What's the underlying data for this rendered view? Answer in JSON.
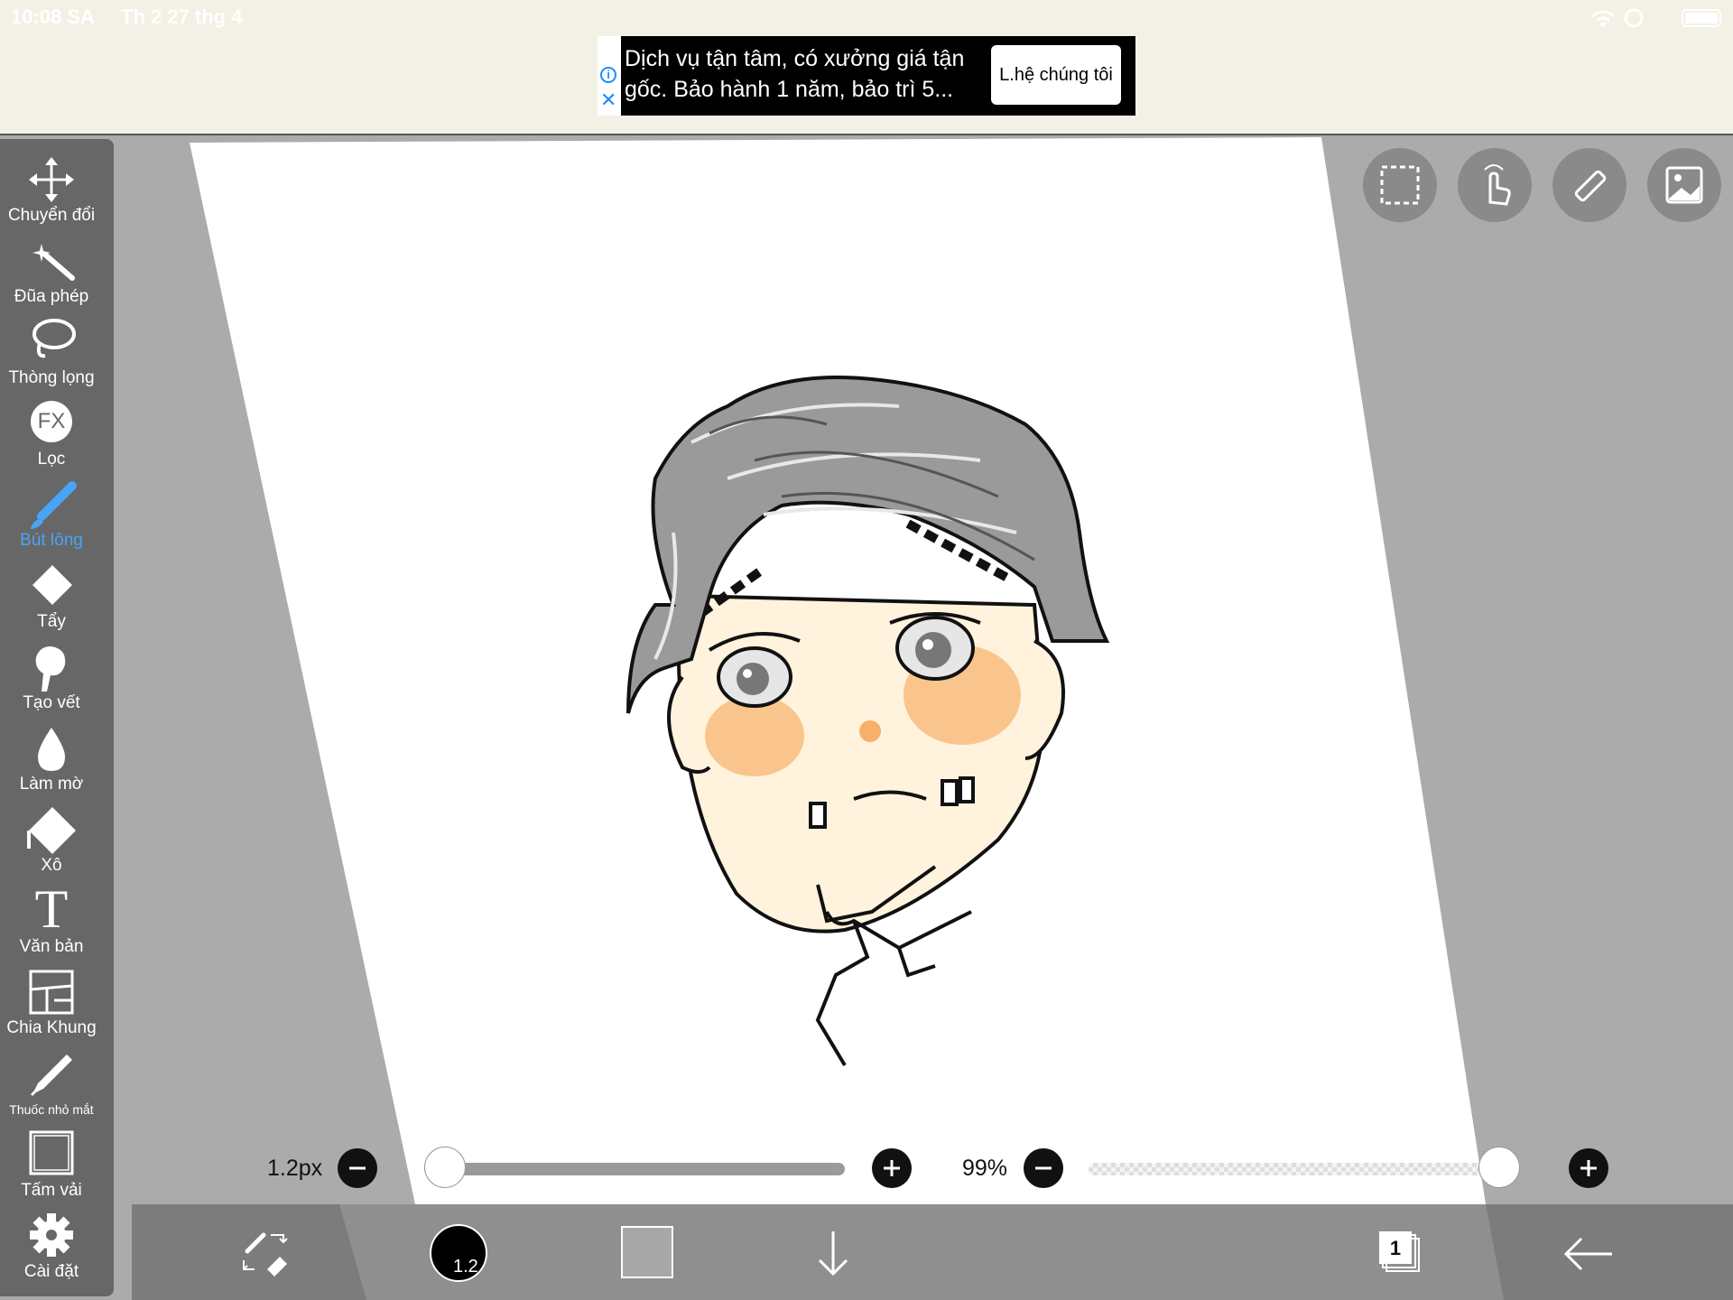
{
  "status": {
    "time": "10:08 SA",
    "date": "Th 2 27 thg 4"
  },
  "ad": {
    "text": "Dịch vụ tận tâm, có xưởng giá tận gốc. Bảo hành 1 năm, bảo trì 5...",
    "cta": "L.hệ chúng tôi",
    "info_icon": "i",
    "close_icon": "✕"
  },
  "sidebar": {
    "tools": [
      {
        "label": "Chuyển đổi"
      },
      {
        "label": "Đũa phép"
      },
      {
        "label": "Thòng lọng"
      },
      {
        "label": "Lọc",
        "icon_text": "FX"
      },
      {
        "label": "Bút lông"
      },
      {
        "label": "Tẩy"
      },
      {
        "label": "Tạo vết"
      },
      {
        "label": "Làm mờ"
      },
      {
        "label": "Xô"
      },
      {
        "label": "Văn bản",
        "icon_text": "T"
      },
      {
        "label": "Chia Khung"
      },
      {
        "label": "Thuốc nhỏ mắt"
      },
      {
        "label": "Tấm vải"
      },
      {
        "label": "Cài đặt"
      }
    ],
    "active_tool": "Bút lông",
    "active_color": "#4aa3f7"
  },
  "sliders": {
    "brush_size": {
      "label": "1.2px",
      "value": 0.05
    },
    "opacity": {
      "label": "99%",
      "value": 0.99
    }
  },
  "bottombar": {
    "brush_size_badge": "1.2",
    "layers_count": "1",
    "primary_color": "#000000",
    "secondary_color": "#a8a8a8"
  }
}
